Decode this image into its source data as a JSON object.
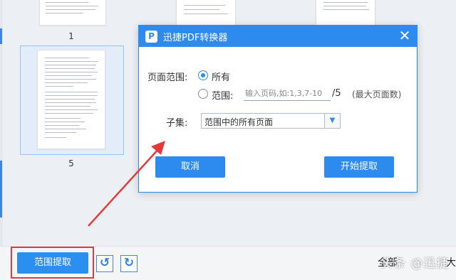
{
  "thumbnails": [
    {
      "page_label": "1"
    },
    {
      "page_label": "5"
    }
  ],
  "dialog": {
    "title": "迅捷PDF转换器",
    "logo_glyph": "P",
    "close_glyph": "✕",
    "page_range_label": "页面范围:",
    "option_all": "所有",
    "option_range": "范围:",
    "range_placeholder": "输入页码,如:1,3,7-10",
    "total_pages": "/5",
    "max_pages_note": "(最大页面数)",
    "subset_label": "子集:",
    "subset_value": "范围中的所有页面",
    "cancel_label": "取消",
    "start_label": "开始提取"
  },
  "bottom_bar": {
    "range_extract_label": "范围提取",
    "rotate_left_glyph": "↺",
    "rotate_right_glyph": "↻",
    "partial_text": "全部",
    "partial_text_right": "大",
    "watermark": "头条 @迅捷"
  },
  "colors": {
    "accent": "#2d8bef",
    "highlight": "#e23a3a"
  }
}
